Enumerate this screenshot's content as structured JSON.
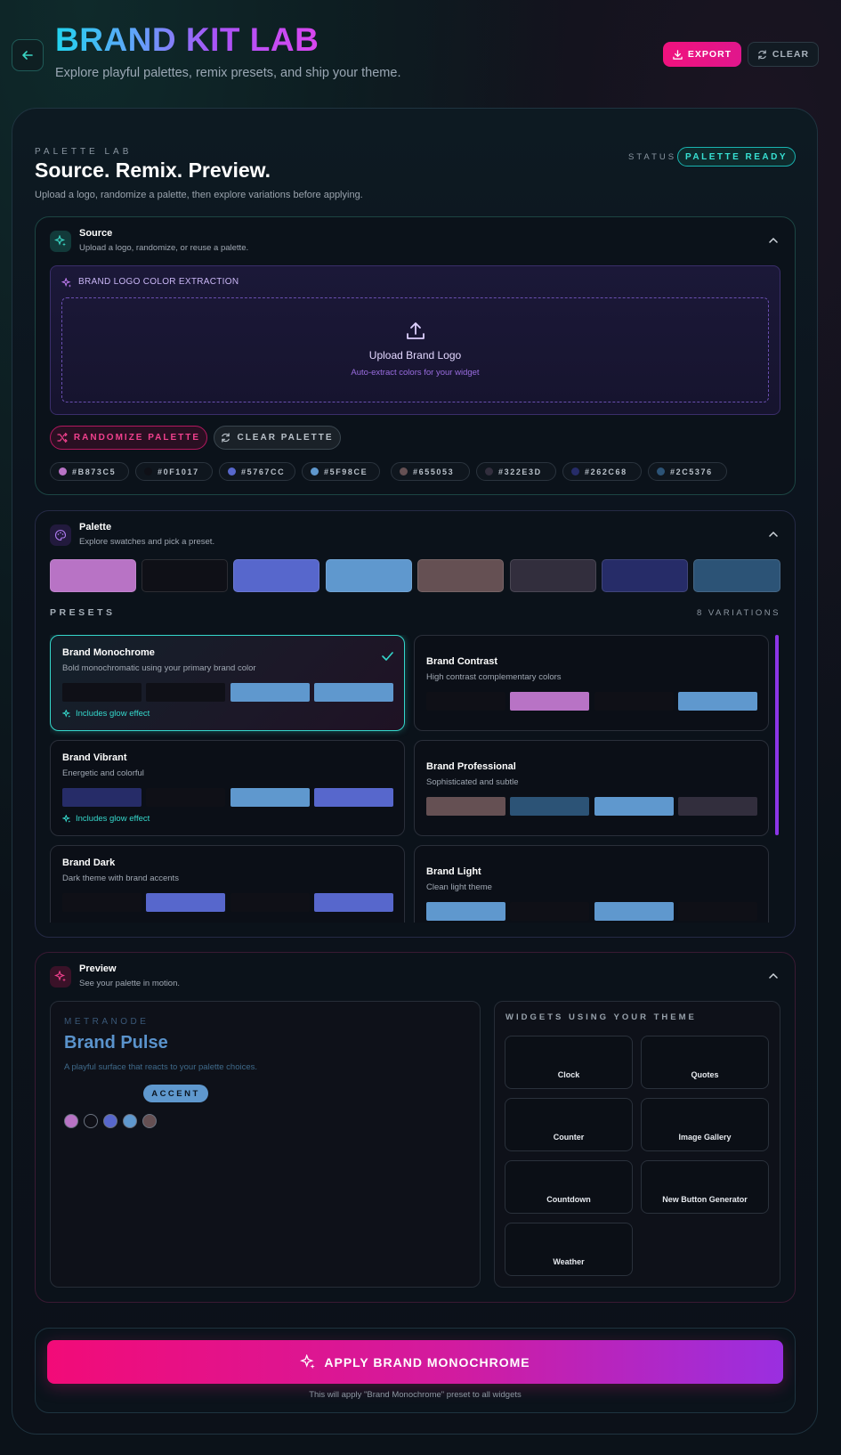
{
  "header": {
    "title": "BRAND KIT LAB",
    "subtitle": "Explore playful palettes, remix presets, and ship your theme.",
    "export_label": "EXPORT",
    "clear_label": "CLEAR"
  },
  "lab": {
    "kicker": "PALETTE LAB",
    "title": "Source. Remix. Preview.",
    "subtitle": "Upload a logo, randomize a palette, then explore variations before applying.",
    "status_label": "STATUS",
    "status_value": "PALETTE READY"
  },
  "source": {
    "title": "Source",
    "desc": "Upload a logo, randomize, or reuse a palette.",
    "extract_label": "BRAND LOGO COLOR EXTRACTION",
    "upload_title": "Upload Brand Logo",
    "upload_sub": "Auto-extract colors for your widget",
    "randomize_label": "RANDOMIZE PALETTE",
    "clear_palette_label": "CLEAR PALETTE",
    "chips": [
      "#B873C5",
      "#0F1017",
      "#5767CC",
      "#5F98CE",
      "#655053",
      "#322E3D",
      "#262C68",
      "#2C5376"
    ]
  },
  "palette": {
    "title": "Palette",
    "desc": "Explore swatches and pick a preset.",
    "colors": [
      "#B873C5",
      "#0F1017",
      "#5767CC",
      "#5F98CE",
      "#655053",
      "#322E3D",
      "#262C68",
      "#2C5376"
    ],
    "presets_label": "PRESETS",
    "variations_label": "8 VARIATIONS",
    "presets": [
      {
        "name": "Brand Monochrome",
        "desc": "Bold monochromatic using your primary brand color",
        "glow": "Includes glow effect",
        "bars": [
          "#0F1017",
          "#0F1017",
          "#5F98CE",
          "#5F98CE"
        ]
      },
      {
        "name": "Brand Contrast",
        "desc": "High contrast complementary colors",
        "bars": [
          "#0F1017",
          "#B873C5",
          "#0F1017",
          "#5F98CE"
        ]
      },
      {
        "name": "Brand Vibrant",
        "desc": "Energetic and colorful",
        "glow": "Includes glow effect",
        "bars": [
          "#262C68",
          "#0F1017",
          "#5F98CE",
          "#5767CC"
        ]
      },
      {
        "name": "Brand Professional",
        "desc": "Sophisticated and subtle",
        "bars": [
          "#655053",
          "#2C5376",
          "#5F98CE",
          "#322E3D"
        ]
      },
      {
        "name": "Brand Dark",
        "desc": "Dark theme with brand accents",
        "bars": [
          "#0F1017",
          "#5767CC",
          "#0F1017",
          "#5767CC"
        ]
      },
      {
        "name": "Brand Light",
        "desc": "Clean light theme",
        "bars": [
          "#5F98CE",
          "#0F1017",
          "#5F98CE",
          "#0F1017"
        ]
      }
    ]
  },
  "preview": {
    "title": "Preview",
    "desc": "See your palette in motion.",
    "kicker": "METRANODE",
    "card_title": "Brand Pulse",
    "card_sub": "A playful surface that reacts to your palette choices.",
    "accent_label": "ACCENT",
    "dots": [
      "#B873C5",
      "#0F1017",
      "#5767CC",
      "#5F98CE",
      "#655053"
    ],
    "widgets_title": "WIDGETS USING YOUR THEME",
    "widgets": [
      "Clock",
      "Quotes",
      "Counter",
      "Image Gallery",
      "Countdown",
      "New Button Generator",
      "Weather"
    ]
  },
  "apply": {
    "label": "APPLY BRAND MONOCHROME",
    "note": "This will apply \"Brand Monochrome\" preset to all widgets"
  }
}
